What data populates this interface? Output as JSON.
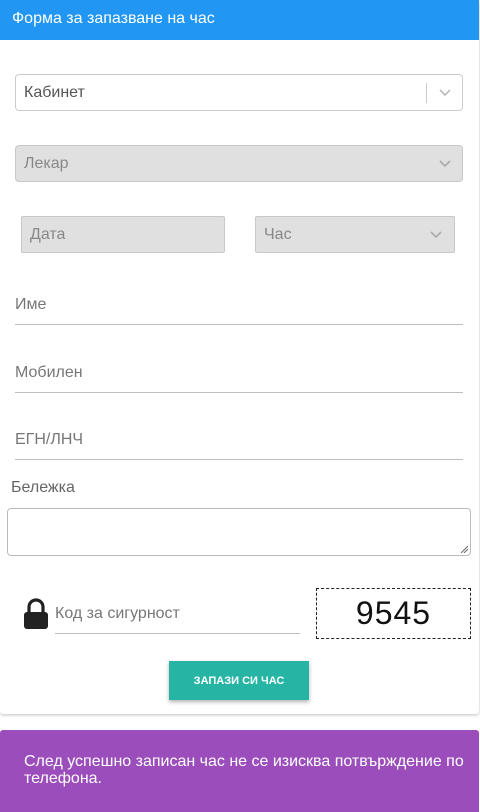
{
  "header": {
    "title": "Форма за запазване на час"
  },
  "form": {
    "cabinet_placeholder": "Кабинет",
    "doctor_placeholder": "Лекар",
    "date_placeholder": "Дата",
    "hour_placeholder": "Час",
    "name_placeholder": "Име",
    "mobile_placeholder": "Мобилен",
    "egn_placeholder": "ЕГН/ЛНЧ",
    "note_label": "Бележка",
    "note_value": "",
    "security_placeholder": "Код за сигурност",
    "captcha_code": "9545",
    "submit_label": "ЗАПАЗИ СИ ЧАС"
  },
  "notice": {
    "text": "След успешно записан час не се изисква потвърждение по телефона."
  },
  "colors": {
    "header": "#2196f3",
    "button": "#26b5a5",
    "notice": "#9b4dbb"
  },
  "icons": {
    "lock": "lock-icon",
    "dropdown": "chevron-down-icon",
    "resize": "resize-handle-icon"
  }
}
